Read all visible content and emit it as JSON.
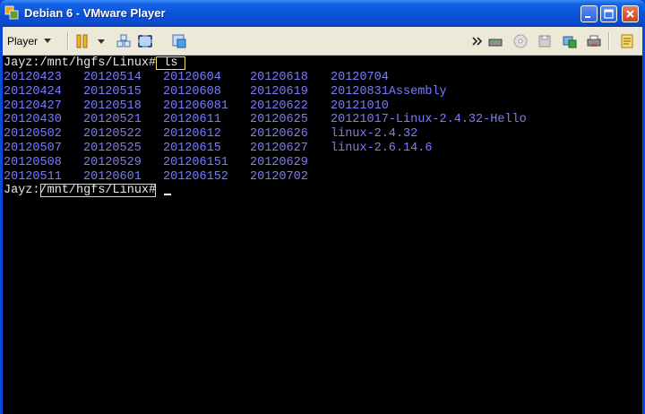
{
  "window": {
    "title": "Debian 6 - VMware Player",
    "minimize_icon": "minimize-icon",
    "maximize_icon": "maximize-icon",
    "close_icon": "close-icon"
  },
  "toolbar": {
    "player_label": "Player",
    "icons": [
      "pause-icon",
      "send-ctrl-alt-del-icon",
      "fullscreen-icon",
      "unity-icon",
      "double-chevron-icon",
      "network-adapter-icon",
      "cd-drive-icon",
      "floppy-icon",
      "usb-device-icon",
      "printer-icon",
      "message-log-icon"
    ]
  },
  "terminal": {
    "prompt1": "Jayz:/mnt/hgfs/Linux#",
    "command": "ls",
    "listing_rows": [
      [
        "20120423",
        "20120514",
        "20120604",
        "20120618",
        "20120704"
      ],
      [
        "20120424",
        "20120515",
        "20120608",
        "20120619",
        "20120831Assembly"
      ],
      [
        "20120427",
        "20120518",
        "201206081",
        "20120622",
        "20121010"
      ],
      [
        "20120430",
        "20120521",
        "20120611",
        "20120625",
        "20121017-Linux-2.4.32-Hello"
      ],
      [
        "20120502",
        "20120522",
        "20120612",
        "20120626",
        "linux-2.4.32"
      ],
      [
        "20120507",
        "20120525",
        "20120615",
        "20120627",
        "linux-2.6.14.6"
      ],
      [
        "20120508",
        "20120529",
        "201206151",
        "20120629",
        ""
      ],
      [
        "20120511",
        "20120601",
        "201206152",
        "20120702",
        ""
      ]
    ],
    "prompt2_user": "Jayz:",
    "prompt2_path": "/mnt/hgfs/Linux#"
  },
  "colors": {
    "title_bar": "#0a52d8",
    "toolbar_bg": "#ece9d8",
    "terminal_bg": "#000000",
    "prompt_text": "#e8e8e8",
    "listing_text": "#7b7bff",
    "highlight_box": "#f0e060"
  }
}
